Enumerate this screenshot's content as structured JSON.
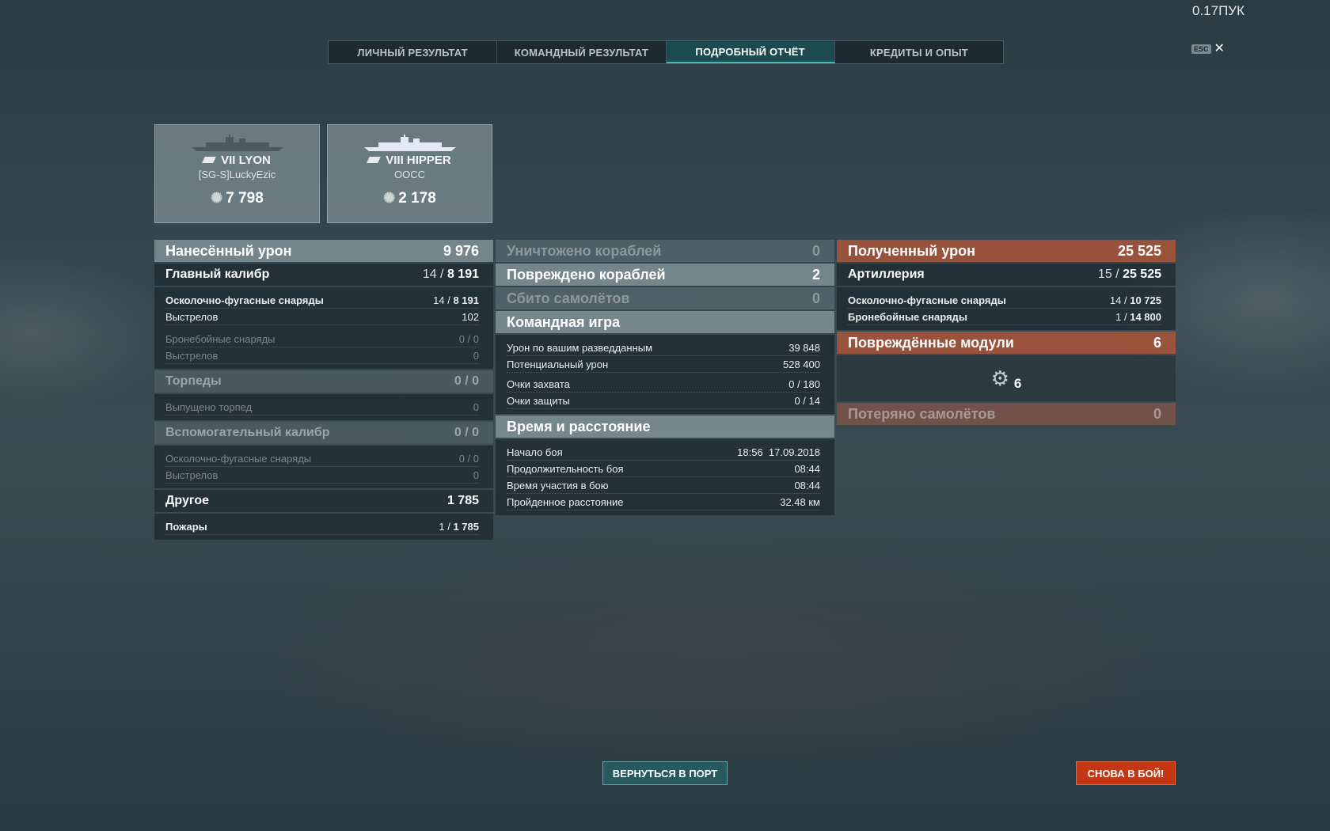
{
  "version": "0.17ПУК",
  "tabs": [
    "ЛИЧНЫЙ РЕЗУЛЬТАТ",
    "КОМАНДНЫЙ РЕЗУЛЬТАТ",
    "ПОДРОБНЫЙ ОТЧЁТ",
    "КРЕДИТЫ И ОПЫТ"
  ],
  "active_tab": "ПОДРОБНЫЙ ОТЧЁТ",
  "esc": {
    "key": "ESC",
    "close": "✕"
  },
  "player_card": {
    "ship": "VII LYON",
    "player": "[SG-S]LuckyEzic",
    "damage": "7 798"
  },
  "enemy_card": {
    "ship": "VIII HIPPER",
    "player": "OOCC",
    "damage": "2 178"
  },
  "dealt": {
    "title": "Нанесённый урон",
    "total": "9 976",
    "main": {
      "label": "Главный калибр",
      "hits": "14",
      "dmg": "8 191"
    },
    "he": {
      "label": "Осколочно-фугасные снаряды",
      "hits": "14",
      "dmg": "8 191"
    },
    "he_shots": {
      "label": "Выстрелов",
      "value": "102"
    },
    "ap": {
      "label": "Бронебойные снаряды",
      "value": "0 / 0"
    },
    "ap_shots": {
      "label": "Выстрелов",
      "value": "0"
    },
    "torp": {
      "label": "Торпеды",
      "value": "0 / 0"
    },
    "torp_fired": {
      "label": "Выпущено торпед",
      "value": "0"
    },
    "sec": {
      "label": "Вспомогательный калибр",
      "value": "0 / 0"
    },
    "sec_he": {
      "label": "Осколочно-фугасные снаряды",
      "value": "0 / 0"
    },
    "sec_shots": {
      "label": "Выстрелов",
      "value": "0"
    },
    "other": {
      "label": "Другое",
      "value": "1 785"
    },
    "fires": {
      "label": "Пожары",
      "hits": "1",
      "dmg": "1 785"
    }
  },
  "mid": {
    "destroyed": {
      "label": "Уничтожено кораблей",
      "value": "0"
    },
    "damaged": {
      "label": "Повреждено кораблей",
      "value": "2"
    },
    "planes": {
      "label": "Сбито самолётов",
      "value": "0"
    },
    "team_title": "Командная игра",
    "spotting": {
      "label": "Урон по вашим разведданным",
      "value": "39 848"
    },
    "potential": {
      "label": "Потенциальный урон",
      "value": "528 400"
    },
    "capture": {
      "label": "Очки захвата",
      "value": "0 / 180"
    },
    "defense": {
      "label": "Очки защиты",
      "value": "0 / 14"
    },
    "time_title": "Время и расстояние",
    "start": {
      "label": "Начало боя",
      "value": "18:56  17.09.2018"
    },
    "duration": {
      "label": "Продолжительность боя",
      "value": "08:44"
    },
    "participation": {
      "label": "Время участия в бою",
      "value": "08:44"
    },
    "distance": {
      "label": "Пройденное расстояние",
      "value": "32.48 км"
    }
  },
  "received": {
    "title": "Полученный урон",
    "total": "25 525",
    "art": {
      "label": "Артиллерия",
      "hits": "15",
      "dmg": "25 525"
    },
    "he": {
      "label": "Осколочно-фугасные снаряды",
      "hits": "14",
      "dmg": "10 725"
    },
    "ap": {
      "label": "Бронебойные снаряды",
      "hits": "1",
      "dmg": "14 800"
    },
    "modules": {
      "label": "Повреждённые модули",
      "value": "6",
      "icon_count": "6"
    },
    "planes_lost": {
      "label": "Потеряно самолётов",
      "value": "0"
    }
  },
  "buttons": {
    "port": "ВЕРНУТЬСЯ В ПОРТ",
    "battle": "СНОВА В БОЙ!"
  }
}
